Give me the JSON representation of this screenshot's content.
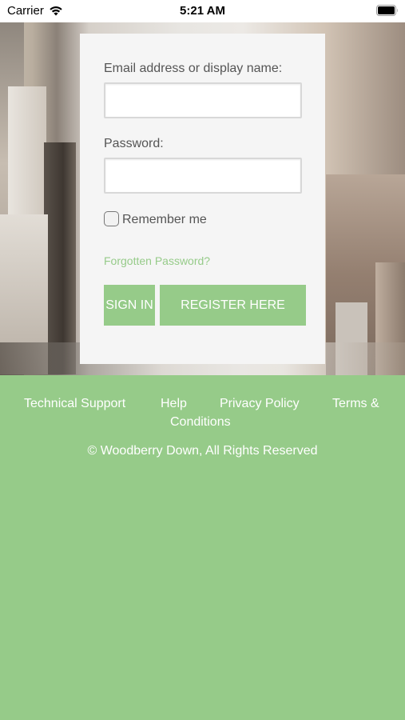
{
  "status_bar": {
    "carrier": "Carrier",
    "time": "5:21 AM",
    "wifi_icon": "wifi-icon",
    "battery_icon": "battery-icon"
  },
  "login": {
    "email_label": "Email address or display name:",
    "email_value": "",
    "password_label": "Password:",
    "password_value": "",
    "remember_label": "Remember me",
    "remember_checked": false,
    "forgot_link": "Forgotten Password?",
    "sign_in_label": "SIGN IN",
    "register_label": "REGISTER HERE"
  },
  "footer": {
    "links": [
      "Technical Support",
      "Help",
      "Privacy Policy",
      "Terms &",
      "Conditions"
    ],
    "copyright": "© Woodberry Down, All Rights Reserved"
  },
  "colors": {
    "accent": "#96cb89",
    "card_bg": "#f5f5f5"
  }
}
